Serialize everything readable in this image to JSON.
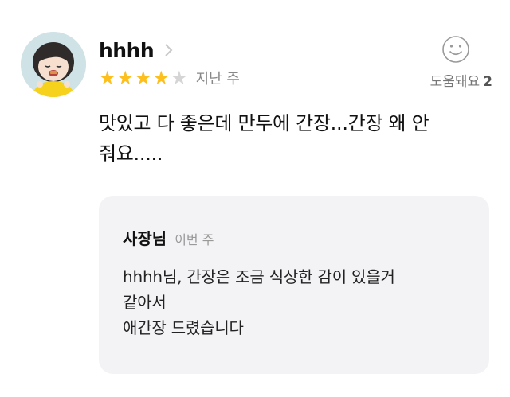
{
  "review": {
    "author": "hhhh",
    "rating": 4,
    "rating_max": 5,
    "date": "지난 주",
    "helpful_label": "도움돼요",
    "helpful_count": "2",
    "text": "맛있고 다 좋은데 만두에 간장...간장 왜 안\n줘요.....",
    "icons": {
      "avatar": "avatar-image",
      "chevron": "chevron-right-icon",
      "helpful": "smile-icon",
      "star": "star-icon"
    },
    "colors": {
      "star_filled": "#fcbf1e",
      "star_empty": "#d5d5d5",
      "reply_bg": "#f3f3f5"
    }
  },
  "reply": {
    "owner": "사장님",
    "date": "이번 주",
    "text": "hhhh님, 간장은 조금 식상한 감이 있을거\n같아서\n애간장 드렸습니다"
  }
}
